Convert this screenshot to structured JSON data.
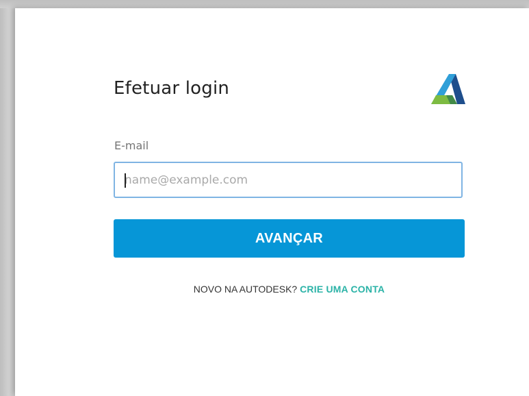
{
  "login": {
    "title": "Efetuar login",
    "email_label": "E-mail",
    "email_placeholder": "name@example.com",
    "email_value": "",
    "next_button_label": "AVANÇAR",
    "signup_prompt": "NOVO NA AUTODESK?",
    "signup_link_label": "CRIE UMA CONTA"
  },
  "logo": {
    "icon": "autodesk-logo-icon"
  },
  "colors": {
    "primary_button": "#0696d7",
    "input_focus_border": "#7fb4e3",
    "link": "#2bb3a7",
    "logo_dark_blue": "#1e4e8c",
    "logo_teal": "#2f9fd8",
    "logo_green": "#7dbb42"
  }
}
